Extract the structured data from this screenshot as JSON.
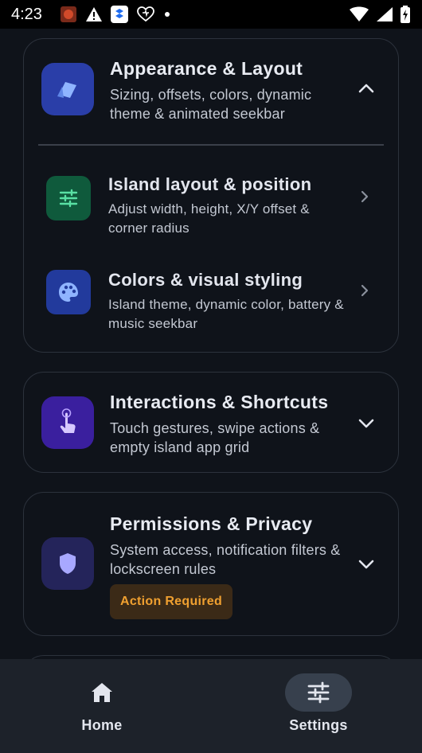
{
  "status_bar": {
    "time": "4:23"
  },
  "sections": [
    {
      "title": "Appearance & Layout",
      "description": "Sizing, offsets, colors, dynamic theme & animated seekbar",
      "icon": "palette-card-icon",
      "icon_color": "#2a3ea8",
      "expanded": true,
      "items": [
        {
          "title": "Island layout & position",
          "description": "Adjust width, height, X/Y offset & corner radius",
          "icon": "tune-sliders-icon",
          "icon_color": "#0f5a3c"
        },
        {
          "title": "Colors & visual styling",
          "description": "Island theme, dynamic color, battery & music seekbar",
          "icon": "palette-icon",
          "icon_color": "#223a9c"
        }
      ]
    },
    {
      "title": "Interactions & Shortcuts",
      "description": "Touch gestures, swipe actions & empty island app grid",
      "icon": "touch-icon",
      "icon_color": "#3a1f9e",
      "expanded": false
    },
    {
      "title": "Permissions & Privacy",
      "description": "System access, notification filters & lockscreen rules",
      "icon": "shield-icon",
      "icon_color": "#24245a",
      "expanded": false,
      "badge": "Action Required"
    }
  ],
  "nav": {
    "items": [
      {
        "label": "Home",
        "icon": "home-icon",
        "active": false
      },
      {
        "label": "Settings",
        "icon": "sliders-icon",
        "active": true
      }
    ]
  },
  "colors": {
    "background": "#0f131a",
    "card_border": "#2c323c",
    "navbar": "#1d222a",
    "badge_bg": "#3b2a17",
    "badge_text": "#f0a030"
  }
}
